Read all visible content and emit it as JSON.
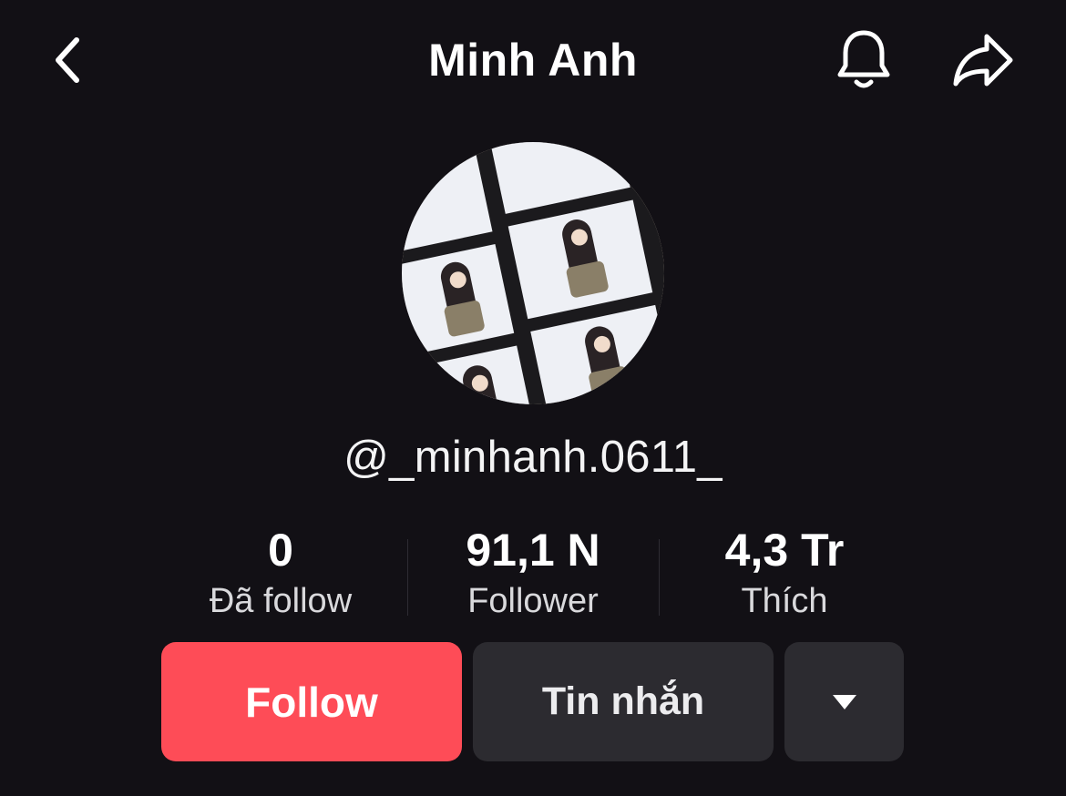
{
  "header": {
    "title": "Minh Anh",
    "back_icon": "chevron-left-icon",
    "notification_icon": "bell-icon",
    "share_icon": "share-arrow-icon"
  },
  "profile": {
    "avatar_alt": "avatar",
    "username": "@_minhanh.0611_"
  },
  "stats": {
    "following": {
      "value": "0",
      "label": "Đã follow"
    },
    "followers": {
      "value": "91,1 N",
      "label": "Follower"
    },
    "likes": {
      "value": "4,3 Tr",
      "label": "Thích"
    }
  },
  "actions": {
    "follow_label": "Follow",
    "message_label": "Tin nhắn",
    "more_icon": "caret-down-icon"
  },
  "colors": {
    "background": "#121015",
    "follow_button": "#fe4c57",
    "secondary_button": "#2c2b30"
  }
}
